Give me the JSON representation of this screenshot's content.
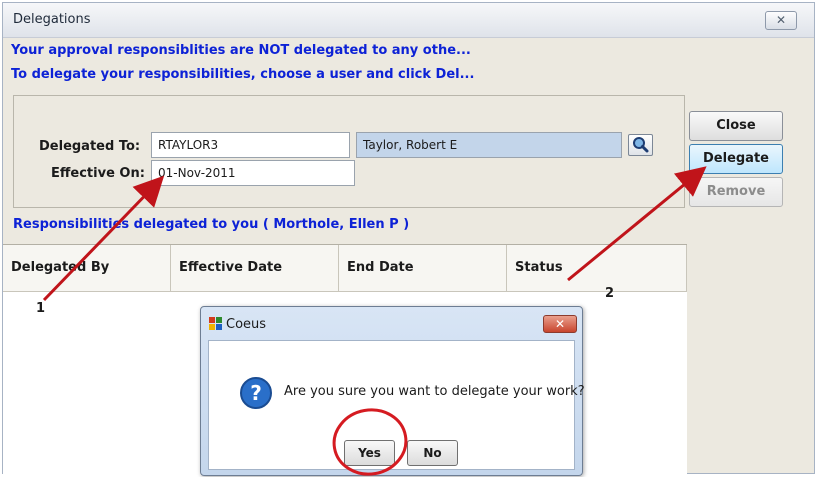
{
  "window": {
    "title": "Delegations",
    "close_glyph": "✕"
  },
  "messages": {
    "line1": "Your approval responsiblities are NOT delegated to any othe...",
    "line2": "To delegate your responsibilities, choose a user and click Del..."
  },
  "form": {
    "delegated_to_label": "Delegated To:",
    "delegated_to_value": "RTAYLOR3",
    "delegated_to_name": "Taylor, Robert E",
    "effective_on_label": "Effective On:",
    "effective_on_value": "01-Nov-2011",
    "lookup_icon": "search-icon"
  },
  "buttons": {
    "close": "Close",
    "delegate": "Delegate",
    "remove": "Remove"
  },
  "section": {
    "title": "Responsibilities delegated to you ( Morthole, Ellen P )"
  },
  "table": {
    "columns": [
      "Delegated By",
      "Effective Date",
      "End Date",
      "Status"
    ]
  },
  "dialog": {
    "title": "Coeus",
    "message": "Are you sure you want to delegate your work?",
    "yes": "Yes",
    "no": "No",
    "icon": "question-icon",
    "close_glyph": "✕"
  },
  "annotations": {
    "marker1": "1",
    "marker2": "2",
    "arrow_color": "#c0141a"
  }
}
